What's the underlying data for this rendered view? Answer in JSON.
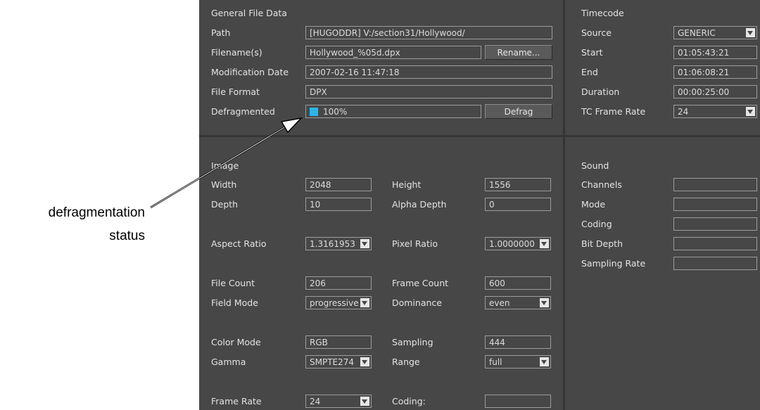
{
  "annotation": {
    "line1": "defragmentation",
    "line2": "status"
  },
  "general": {
    "title": "General File Data",
    "path_label": "Path",
    "path_value": "[HUGODDR] V:/section31/Hollywood/",
    "filename_label": "Filename(s)",
    "filename_value": "Hollywood_%05d.dpx",
    "rename_button": "Rename...",
    "mod_label": "Modification Date",
    "mod_value": "2007-02-16 11:47:18",
    "format_label": "File Format",
    "format_value": "DPX",
    "defrag_label": "Defragmented",
    "defrag_value": "100%",
    "defrag_button": "Defrag",
    "defrag_fraction": 1.0
  },
  "timecode": {
    "title": "Timecode",
    "source_label": "Source",
    "source_value": "GENERIC",
    "start_label": "Start",
    "start_value": "01:05:43:21",
    "end_label": "End",
    "end_value": "01:06:08:21",
    "duration_label": "Duration",
    "duration_value": "00:00:25:00",
    "rate_label": "TC Frame Rate",
    "rate_value": "24"
  },
  "image": {
    "title": "Image",
    "width_label": "Width",
    "width_value": "2048",
    "height_label": "Height",
    "height_value": "1556",
    "depth_label": "Depth",
    "depth_value": "10",
    "alpha_label": "Alpha Depth",
    "alpha_value": "0",
    "aspect_label": "Aspect Ratio",
    "aspect_value": "1.3161953",
    "pixel_label": "Pixel Ratio",
    "pixel_value": "1.0000000",
    "filecount_label": "File Count",
    "filecount_value": "206",
    "framecount_label": "Frame Count",
    "framecount_value": "600",
    "fieldmode_label": "Field Mode",
    "fieldmode_value": "progressive",
    "dominance_label": "Dominance",
    "dominance_value": "even",
    "colormode_label": "Color Mode",
    "colormode_value": "RGB",
    "sampling_label": "Sampling",
    "sampling_value": "444",
    "gamma_label": "Gamma",
    "gamma_value": "SMPTE274",
    "range_label": "Range",
    "range_value": "full",
    "framerate_label": "Frame Rate",
    "framerate_value": "24",
    "coding_label": "Coding:",
    "coding_value": ""
  },
  "sound": {
    "title": "Sound",
    "channels_label": "Channels",
    "channels_value": "",
    "mode_label": "Mode",
    "mode_value": "",
    "coding_label": "Coding",
    "coding_value": "",
    "bitdepth_label": "Bit Depth",
    "bitdepth_value": "",
    "sampling_label": "Sampling Rate",
    "sampling_value": ""
  },
  "colors": {
    "panel_bg": "#474747",
    "accent_swatch": "#28b6ea",
    "text": "#e4e4e4"
  }
}
